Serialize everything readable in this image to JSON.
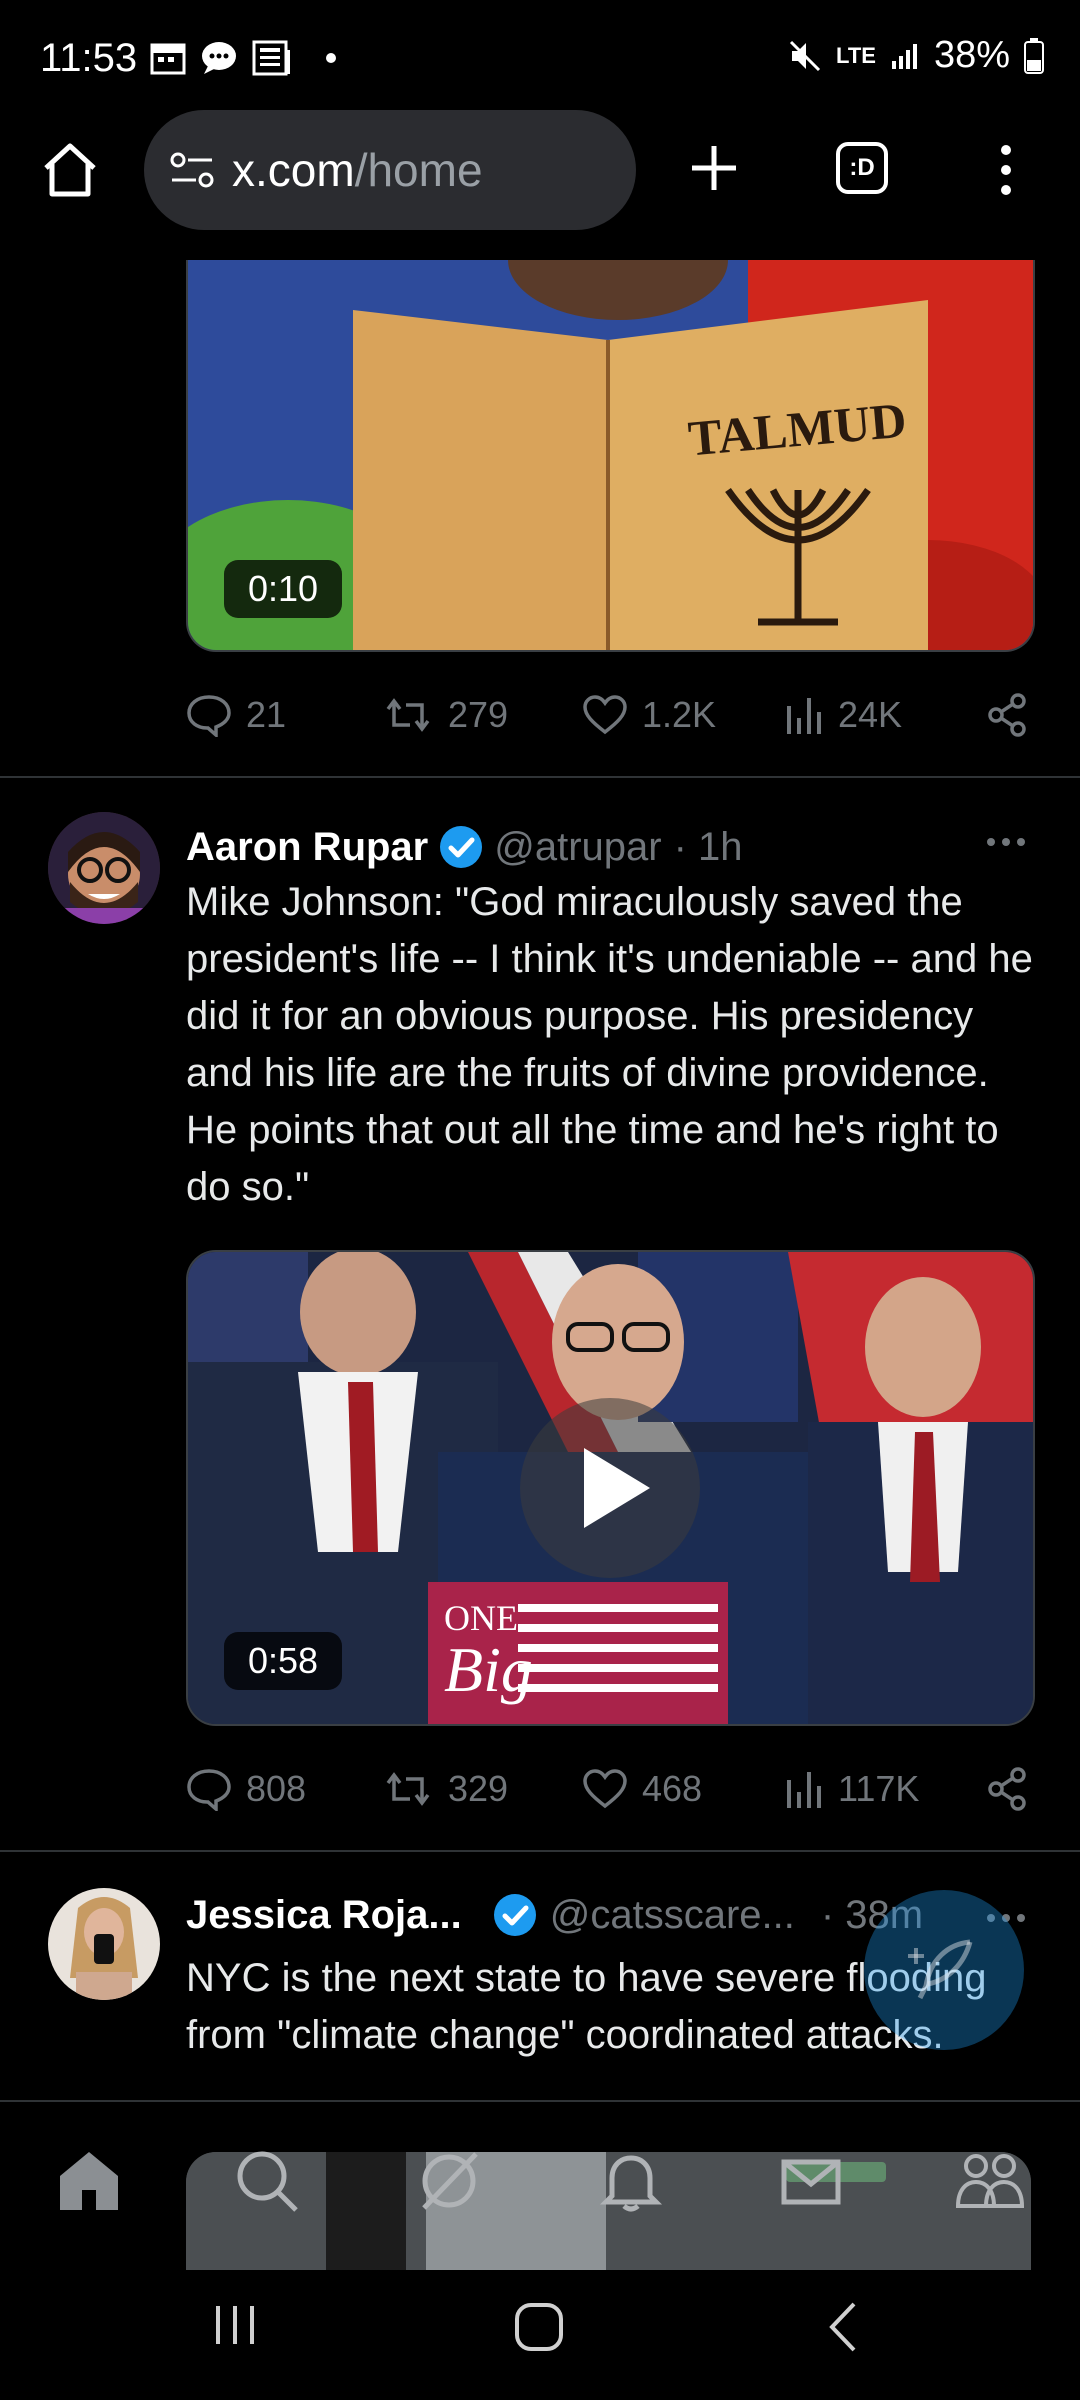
{
  "status_bar": {
    "time": "11:53",
    "network": "LTE",
    "battery": "38%"
  },
  "browser": {
    "url_host": "x.com",
    "url_path": "/home",
    "tab_label": ":D"
  },
  "tweet1": {
    "media_text": "TALMUD",
    "duration": "0:10",
    "replies": "21",
    "reposts": "279",
    "likes": "1.2K",
    "views": "24K"
  },
  "tweet2": {
    "name": "Aaron Rupar",
    "handle": "@atrupar",
    "time": "· 1h",
    "text": "Mike Johnson: \"God miraculously saved the president's life -- I think it's undeniable -- and he did it for an obvious purpose. His presidency and his life are the fruits of divine providence. He points that out all the time and he's right to do so.\"",
    "media_sign_line1": "ONE",
    "media_sign_line2": "Big",
    "duration": "0:58",
    "replies": "808",
    "reposts": "329",
    "likes": "468",
    "views": "117K"
  },
  "tweet3": {
    "name": "Jessica Roja...",
    "handle": "@catsscare...",
    "time": "· 38m",
    "text": "NYC is the next state to have severe flooding from \"climate change\" coordinated attacks."
  },
  "colors": {
    "accent": "#1d9bf0",
    "muted": "#71767b",
    "background": "#000000"
  }
}
